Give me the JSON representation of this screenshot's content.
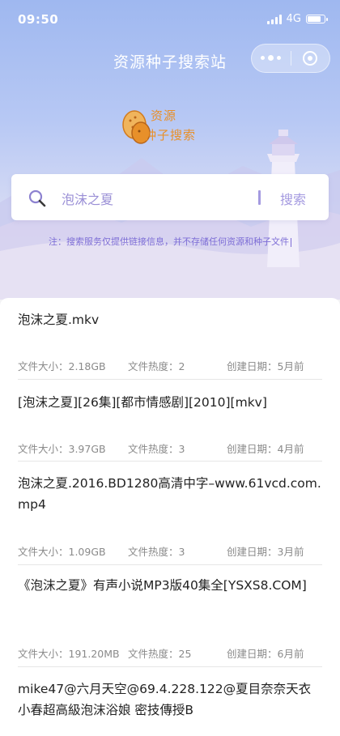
{
  "status_bar": {
    "time": "09:50",
    "network": "4G"
  },
  "nav": {
    "title": "资源种子搜索站"
  },
  "logo": {
    "line1": "资源",
    "line2": "种子搜索"
  },
  "search": {
    "query": "泡沫之夏",
    "button_label": "搜索"
  },
  "notice": "注：搜索服务仅提供链接信息，并不存储任何资源和种子文件",
  "results": [
    {
      "title": "泡沫之夏.mkv",
      "size": "文件大小：2.18GB",
      "heat": "文件热度：2",
      "date": "创建日期：5月前"
    },
    {
      "title": "[泡沫之夏][26集][都市情感剧][2010][mkv]",
      "size": "文件大小：3.97GB",
      "heat": "文件热度：3",
      "date": "创建日期：4月前"
    },
    {
      "title": "泡沫之夏.2016.BD1280高清中字–www.61vcd.com.mp4",
      "size": "文件大小：1.09GB",
      "heat": "文件热度：3",
      "date": "创建日期：3月前"
    },
    {
      "title": "《泡沫之夏》有声小说MP3版40集全[YSXS8.COM]",
      "size": "文件大小：191.20MB",
      "heat": "文件热度：25",
      "date": "创建日期：6月前"
    },
    {
      "title": "mike47@六月天空@69.4.228.122@夏目奈奈天衣小春超高級泡沫浴娘 密技傳授B"
    }
  ],
  "colors": {
    "accent": "#9a8fd6",
    "logo_orange": "#e8902a",
    "notice": "#7d6dd6"
  }
}
